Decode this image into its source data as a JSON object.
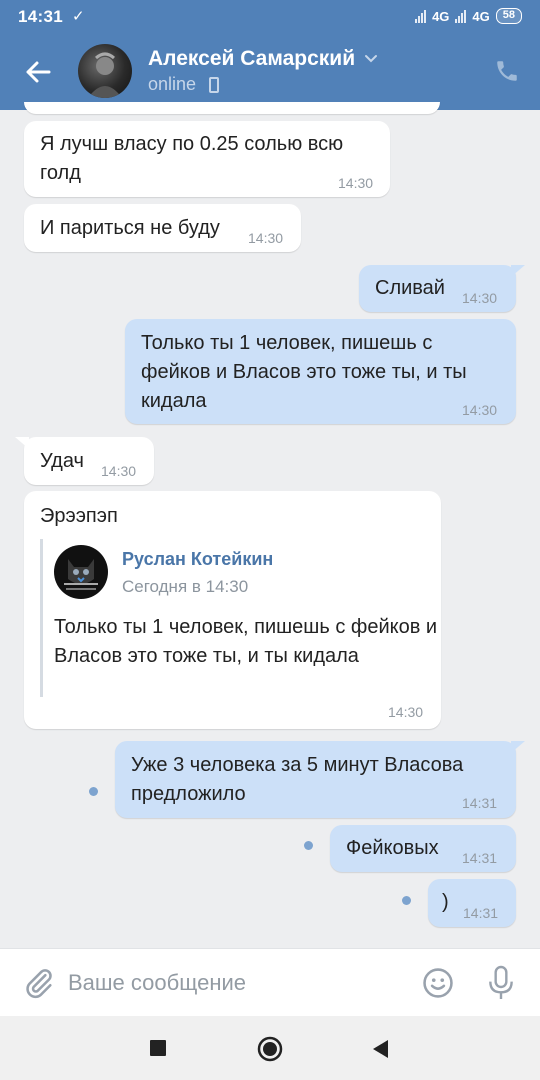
{
  "status_bar": {
    "time": "14:31",
    "network1": "4G",
    "network2": "4G",
    "battery": "58"
  },
  "header": {
    "contact_name": "Алексей Самарский",
    "presence": "online"
  },
  "messages": [
    {
      "dir": "in",
      "text": "Я лучш власу по 0.25 солью всю голд",
      "time": "14:30"
    },
    {
      "dir": "in",
      "text": "И париться не буду",
      "time": "14:30"
    },
    {
      "dir": "out",
      "text": "Сливай",
      "time": "14:30"
    },
    {
      "dir": "out",
      "text": "Только ты 1 человек, пишешь с фейков и Власов это тоже ты, и ты кидала",
      "time": "14:30"
    },
    {
      "dir": "in",
      "text": "Удач",
      "time": "14:30"
    },
    {
      "dir": "in",
      "text": "Эрээпэп",
      "time": "14:30",
      "forwarded": {
        "author": "Руслан Котейкин",
        "date": "Сегодня в 14:30",
        "text": "Только ты 1 человек, пишешь с фейков и Власов это тоже ты, и ты кидала"
      }
    },
    {
      "dir": "out",
      "text": "Уже 3 человека за 5 минут Власова предложило",
      "time": "14:31",
      "unread": true
    },
    {
      "dir": "out",
      "text": "Фейковых",
      "time": "14:31",
      "unread": true
    },
    {
      "dir": "out",
      "text": ")",
      "time": "14:31",
      "unread": true
    }
  ],
  "composer": {
    "placeholder": "Ваше сообщение"
  },
  "colors": {
    "header": "#5181b8",
    "outgoing_bubble": "#cce0f8",
    "incoming_bubble": "#ffffff",
    "background": "#edeef0",
    "link": "#4a76a8"
  },
  "icons": [
    "back-arrow-icon",
    "chevron-down-icon",
    "phone-icon",
    "paperclip-icon",
    "emoji-icon",
    "microphone-icon",
    "nav-recents-icon",
    "nav-home-icon",
    "nav-back-icon"
  ]
}
